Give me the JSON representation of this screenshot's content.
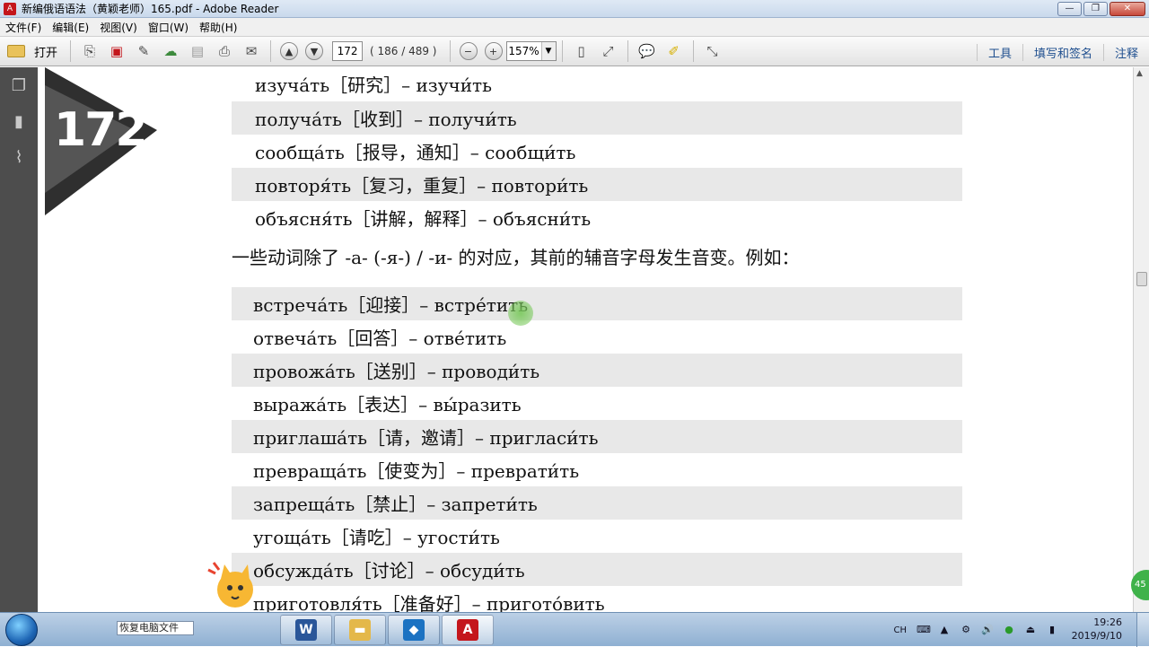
{
  "window": {
    "title": "新编俄语语法（黄颖老师）165.pdf - Adobe Reader"
  },
  "menu": [
    "文件(F)",
    "编辑(E)",
    "视图(V)",
    "窗口(W)",
    "帮助(H)"
  ],
  "toolbar": {
    "open_label": "打开",
    "page_value": "172",
    "page_count": "( 186 / 489 )",
    "zoom_value": "157%",
    "right": [
      "工具",
      "填写和签名",
      "注释"
    ]
  },
  "document": {
    "page_badge": "172",
    "rows_top": [
      "изуча́ть［研究］– изучи́ть",
      "получа́ть［收到］– получи́ть",
      "сообща́ть［报导，通知］– сообщи́ть",
      "повторя́ть［复习，重复］– повтори́ть",
      "объясня́ть［讲解，解释］– объясни́ть"
    ],
    "note": "一些动词除了 -а- (-я-) / -и- 的对应，其前的辅音字母发生音变。例如：",
    "rows_bottom": [
      "встреча́ть［迎接］– встре́тить",
      "отвеча́ть［回答］– отве́тить",
      "провожа́ть［送别］– проводи́ть",
      "выража́ть［表达］– вы́разить",
      "приглаша́ть［请，邀请］– пригласи́ть",
      "превраща́ть［使变为］– преврати́ть",
      "запреща́ть［禁止］– запрети́ть",
      "угоща́ть［请吃］– угости́ть",
      "обсужда́ть［讨论］– обсуди́ть",
      "приготовля́ть［准备好］– пригото́вить"
    ]
  },
  "side_badge": "45",
  "taskbar": {
    "input_value": "恢复电脑文件",
    "tray_lang": "CH",
    "time": "19:26",
    "date": "2019/9/10"
  }
}
